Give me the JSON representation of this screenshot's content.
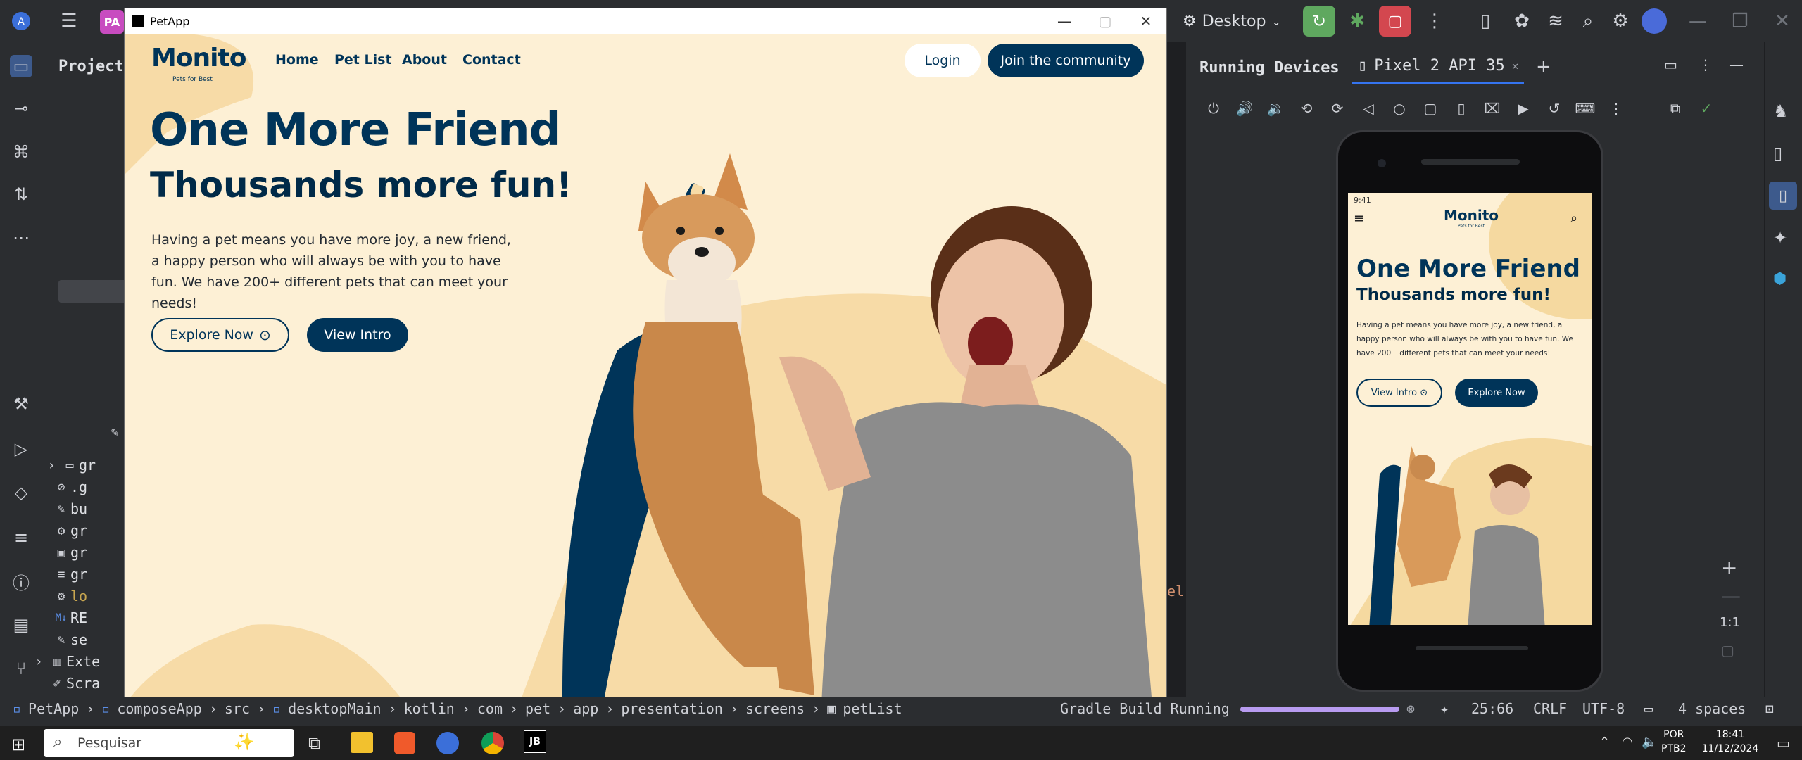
{
  "ide": {
    "project_badge": "PA",
    "run_config": "Desktop",
    "project_panel_title": "Project",
    "tree_items": [
      {
        "label": "gr",
        "icon": "folder"
      },
      {
        "label": ".g",
        "icon": "ignore"
      },
      {
        "label": "bu",
        "icon": "gradle"
      },
      {
        "label": "gr",
        "icon": "gear"
      },
      {
        "label": "gr",
        "icon": "terminal"
      },
      {
        "label": "gr",
        "icon": "lines"
      },
      {
        "label": "lo",
        "icon": "gear"
      },
      {
        "label": "RE",
        "icon": "markdown"
      },
      {
        "label": "se",
        "icon": "gradle"
      },
      {
        "label": "Exte",
        "icon": "library"
      },
      {
        "label": "Scra",
        "icon": "scratch"
      }
    ],
    "editor_fragment": "el",
    "running_devices_title": "Running Devices",
    "device_tab_label": "Pixel 2 API 35",
    "zoom_label": "1:1",
    "breadcrumb": [
      "PetApp",
      "composeApp",
      "src",
      "desktopMain",
      "kotlin",
      "com",
      "pet",
      "app",
      "presentation",
      "screens",
      "petList"
    ],
    "build_status": "Gradle Build Running",
    "cursor_position": "25:66",
    "line_ending": "CRLF",
    "encoding": "UTF-8",
    "indent": "4 spaces"
  },
  "petapp_window": {
    "title": "PetApp",
    "logo": "Monito",
    "logo_tagline": "Pets for Best",
    "nav": [
      "Home",
      "Pet List",
      "About",
      "Contact"
    ],
    "login_label": "Login",
    "join_label": "Join the community",
    "hero_title": "One More Friend",
    "hero_subtitle": "Thousands more fun!",
    "hero_text": "Having a pet means you have more joy, a new friend, a happy person who will always be with you to have fun. We have 200+ different pets that can meet your needs!",
    "explore_label": "Explore Now",
    "intro_label": "View Intro"
  },
  "phone": {
    "status_time": "9:41",
    "logo": "Monito",
    "logo_tagline": "Pets for Best",
    "hero_title": "One More Friend",
    "hero_subtitle": "Thousands more fun!",
    "hero_text": "Having a pet means you have more joy, a new friend, a happy person who will always be with you to have fun. We have 200+ different pets that can meet your needs!",
    "intro_label": "View Intro",
    "explore_label": "Explore Now"
  },
  "taskbar": {
    "search_placeholder": "Pesquisar",
    "language": "POR",
    "keyboard": "PTB2",
    "time": "18:41",
    "date": "11/12/2024"
  }
}
